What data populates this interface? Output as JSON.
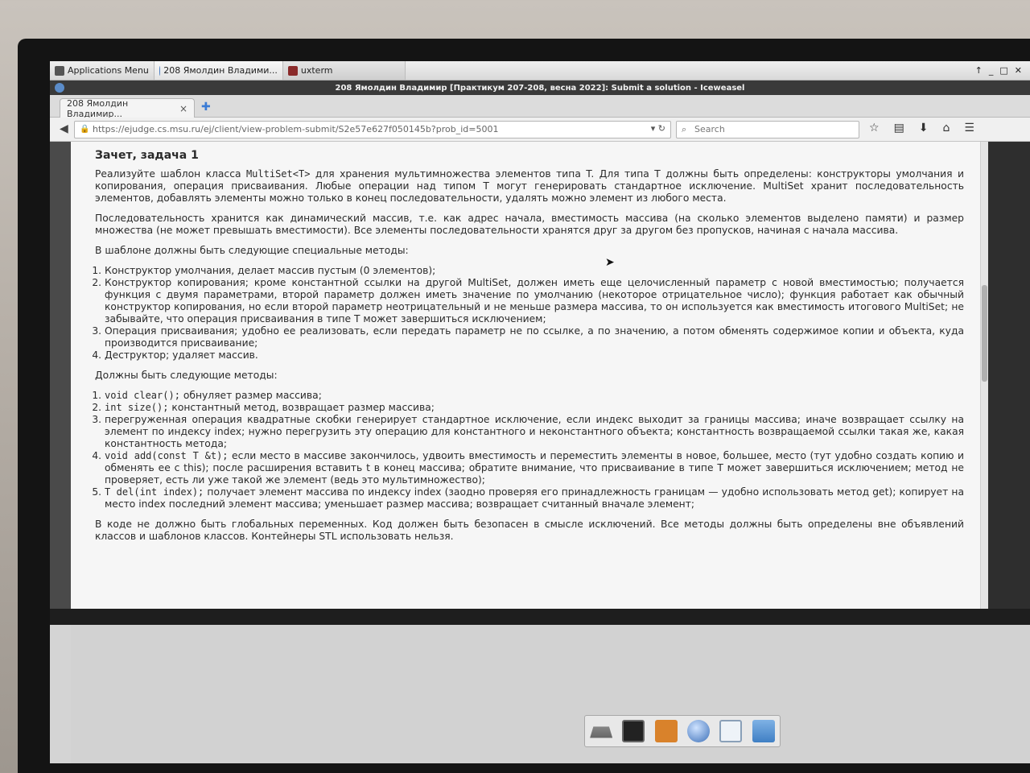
{
  "panel": {
    "menu_label": "Applications Menu",
    "tasks": [
      "208 Ямолдин Владими...",
      "uxterm"
    ]
  },
  "window": {
    "title": "208 Ямолдин Владимир [Практикум 207-208, весна 2022]: Submit a solution - Iceweasel"
  },
  "browser": {
    "tab_label": "208 Ямолдин Владимир...",
    "url": "https://ejudge.cs.msu.ru/ej/client/view-problem-submit/S2e57e627f050145b?prob_id=5001",
    "search_placeholder": "Search"
  },
  "page": {
    "heading": "Зачет, задача 1",
    "intro_before_code": "Реализуйте шаблон класса ",
    "intro_code": "MultiSet<T>",
    "intro_after_code": " для хранения мультимножества элементов типа T. Для типа T должны быть определены: конструкторы умолчания и копирования, операция присваивания. Любые операции над типом T могут генерировать стандартное исключение. MultiSet хранит последовательность элементов, добавлять элементы можно только в конец последовательности, удалять можно элемент из любого места.",
    "storage": "Последовательность хранится как динамический массив, т.е. как адрес начала, вместимость массива (на сколько элементов выделено памяти) и размер множества (не может превышать вместимости). Все элементы последовательности хранятся друг за другом без пропусков, начиная с начала массива.",
    "special_title": "В шаблоне должны быть следующие специальные методы:",
    "special": [
      "Конструктор умолчания, делает массив пустым (0 элементов);",
      "Конструктор копирования; кроме константной ссылки на другой MultiSet, должен иметь еще целочисленный параметр с новой вместимостью; получается функция с двумя параметрами, второй параметр должен иметь значение по умолчанию (некоторое отрицательное число); функция работает как обычный конструктор копирования, но если второй параметр неотрицательный и не меньше размера массива, то он используется как вместимость итогового MultiSet; не забывайте, что операция присваивания в типе T может завершиться исключением;",
      "Операция присваивания; удобно ее реализовать, если передать параметр не по ссылке, а по значению, а потом обменять содержимое копии и объекта, куда производится присваивание;",
      "Деструктор; удаляет массив."
    ],
    "methods_title": "Должны быть следующие методы:",
    "methods": [
      {
        "code": "void clear();",
        "text": " обнуляет размер массива;"
      },
      {
        "code": "int size();",
        "text": " константный метод, возвращает размер массива;"
      },
      {
        "code": "",
        "text": "перегруженная операция квадратные скобки генерирует стандартное исключение, если индекс выходит за границы массива; иначе возвращает ссылку на элемент по индексу index; нужно перегрузить эту операцию для константного и неконстантного объекта; константность возвращаемой ссылки такая же, какая константность метода;"
      },
      {
        "code": "void add(const T &t);",
        "text": " если место в массиве закончилось, удвоить вместимость и переместить элементы в новое, большее, место (тут удобно создать копию и обменять ее с this); после расширения вставить t в конец массива; обратите внимание, что присваивание в типе T может завершиться исключением; метод не проверяет, есть ли уже такой же элемент (ведь это мультимножество);"
      },
      {
        "code": "T del(int index);",
        "text": " получает элемент массива по индексу index (заодно проверяя его принадлежность границам — удобно использовать метод get); копирует на место index последний элемент массива; уменьшает размер массива; возвращает считанный вначале элемент;"
      }
    ],
    "footer": "В коде не должно быть глобальных переменных. Код должен быть безопасен в смысле исключений. Все методы должны быть определены вне объявлений классов и шаблонов классов. Контейнеры STL использовать нельзя."
  },
  "colors": {
    "page_bg": "#f6f6f6",
    "title_bar": "#3a3a3a",
    "bezel": "#141414"
  },
  "dock_icons": [
    "drive-icon",
    "terminal-icon",
    "notes-icon",
    "browser-globe-icon",
    "search-files-icon",
    "folder-icon"
  ]
}
